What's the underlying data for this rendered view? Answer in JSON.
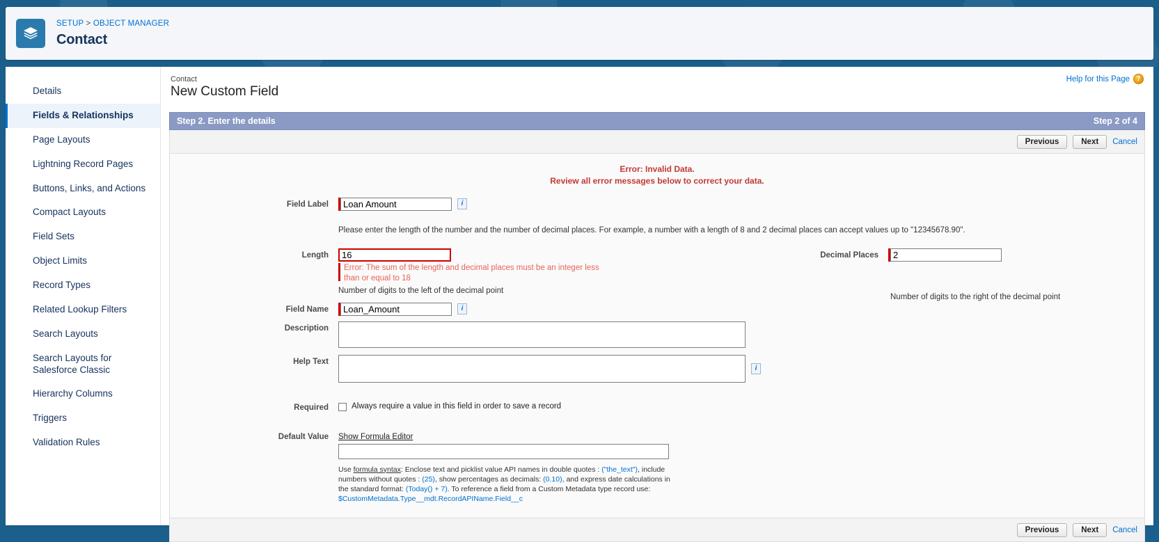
{
  "header": {
    "breadcrumb_setup": "SETUP",
    "breadcrumb_sep": ">",
    "breadcrumb_object": "OBJECT MANAGER",
    "object_title": "Contact",
    "icon": "layers-icon",
    "icon_bg": "#2a7aad",
    "banner_color": "#1a5e8b"
  },
  "sidebar": {
    "items": [
      {
        "label": "Details",
        "active": false
      },
      {
        "label": "Fields & Relationships",
        "active": true
      },
      {
        "label": "Page Layouts",
        "active": false
      },
      {
        "label": "Lightning Record Pages",
        "active": false
      },
      {
        "label": "Buttons, Links, and Actions",
        "active": false
      },
      {
        "label": "Compact Layouts",
        "active": false
      },
      {
        "label": "Field Sets",
        "active": false
      },
      {
        "label": "Object Limits",
        "active": false
      },
      {
        "label": "Record Types",
        "active": false
      },
      {
        "label": "Related Lookup Filters",
        "active": false
      },
      {
        "label": "Search Layouts",
        "active": false
      },
      {
        "label": "Search Layouts for Salesforce Classic",
        "active": false
      },
      {
        "label": "Hierarchy Columns",
        "active": false
      },
      {
        "label": "Triggers",
        "active": false
      },
      {
        "label": "Validation Rules",
        "active": false
      }
    ],
    "active_accent": "#0070d2"
  },
  "main": {
    "help_link": "Help for this Page",
    "help_icon_char": "?",
    "context_label": "Contact",
    "page_title": "New Custom Field",
    "step_bar": {
      "title": "Step 2. Enter the details",
      "progress": "Step 2 of 4",
      "bg": "#8a9ac4"
    },
    "buttons": {
      "previous": "Previous",
      "next": "Next",
      "cancel": "Cancel"
    },
    "error_banner": {
      "line1": "Error: Invalid Data.",
      "line2": "Review all error messages below to correct your data.",
      "color": "#c23934"
    },
    "fields": {
      "field_label": {
        "label": "Field Label",
        "value": "Loan Amount",
        "required": true,
        "has_info": true
      },
      "length_instruction": "Please enter the length of the number and the number of decimal places. For example, a number with a length of 8 and 2 decimal places can accept values up to \"12345678.90\".",
      "length": {
        "label": "Length",
        "value": "16",
        "has_error": true,
        "error_text": "Error: The sum of the length and decimal places must be an integer less than or equal to 18",
        "note": "Number of digits to the left of the decimal point"
      },
      "decimal_places": {
        "label": "Decimal Places",
        "value": "2",
        "required": true,
        "note": "Number of digits to the right of the decimal point"
      },
      "field_name": {
        "label": "Field Name",
        "value": "Loan_Amount",
        "required": true,
        "has_info": true
      },
      "description": {
        "label": "Description",
        "value": ""
      },
      "help_text": {
        "label": "Help Text",
        "value": "",
        "has_info": true
      },
      "required_checkbox": {
        "label": "Required",
        "checkbox_label": "Always require a value in this field in order to save a record",
        "checked": false
      },
      "default_value": {
        "label": "Default Value",
        "formula_editor_link": "Show Formula Editor",
        "value": "",
        "syntax_prefix": "Use ",
        "syntax_link": "formula syntax",
        "syntax_part1": ": Enclose text and picklist value API names in double quotes : ",
        "syntax_code1": "(\"the_text\")",
        "syntax_part2": ", include numbers without quotes : ",
        "syntax_code2": "(25)",
        "syntax_part3": ", show percentages as decimals: ",
        "syntax_code3": "(0.10)",
        "syntax_part4": ", and express date calculations in the standard format: ",
        "syntax_code4": "(Today() + 7)",
        "syntax_part5": ". To reference a field from a Custom Metadata type record use: ",
        "syntax_code5": "$CustomMetadata.Type__mdt.RecordAPIName.Field__c"
      }
    }
  }
}
